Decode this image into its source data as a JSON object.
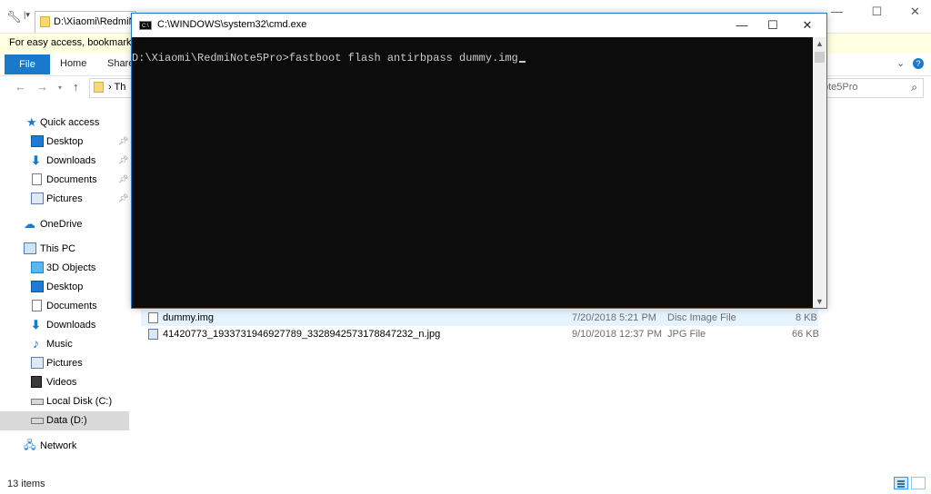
{
  "explorer": {
    "title_path": "D:\\Xiaomi\\RedmiN",
    "infobar_text": "For easy access, bookmarks c",
    "ribbon": {
      "file_tab": "File",
      "tabs": [
        "Home",
        "Share"
      ]
    },
    "address_visible": "Th",
    "search_placeholder": "ote5Pro",
    "nav": {
      "quick_access": "Quick access",
      "quick_items": [
        "Desktop",
        "Downloads",
        "Documents",
        "Pictures"
      ],
      "onedrive": "OneDrive",
      "this_pc": "This PC",
      "pc_items": [
        "3D Objects",
        "Desktop",
        "Documents",
        "Downloads",
        "Music",
        "Pictures",
        "Videos",
        "Local Disk (C:)",
        "Data (D:)"
      ],
      "network": "Network"
    },
    "files": [
      {
        "name": "dummy.img",
        "date": "7/20/2018 5:21 PM",
        "type": "Disc Image File",
        "size": "8 KB"
      },
      {
        "name": "41420773_1933731946927789_3328942573178847232_n.jpg",
        "date": "9/10/2018 12:37 PM",
        "type": "JPG File",
        "size": "66 KB"
      }
    ],
    "status_items": "13 items"
  },
  "cmd": {
    "title": "C:\\WINDOWS\\system32\\cmd.exe",
    "prompt": "D:\\Xiaomi\\RedmiNote5Pro>",
    "command": "fastboot flash antirbpass dummy.img",
    "icon_text": "C:\\"
  },
  "colors": {
    "accent": "#1979ca",
    "console_bg": "#0c0c0c",
    "console_fg": "#cccccc",
    "infobar": "#ffffe1"
  }
}
